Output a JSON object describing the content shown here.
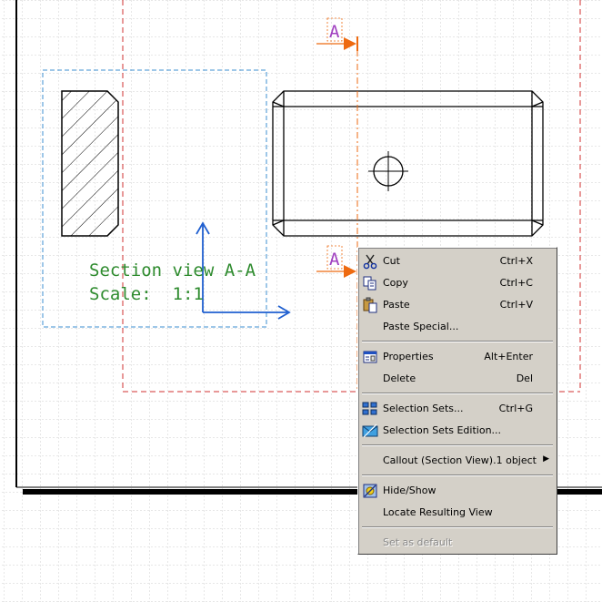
{
  "drawing": {
    "section_title": "Section view A-A",
    "scale_label": "Scale:  1:1",
    "callout_top_label": "A",
    "callout_bottom_label": "A",
    "colors": {
      "grid": "#cfcfcf",
      "sheet_border": "#000000",
      "view_frame": "#3c8fd0",
      "red_frame": "#d03030",
      "callout": "#ee6a10",
      "callout_label": "#a040c0",
      "axis": "#1f5fd0",
      "text": "#2e8b2e"
    }
  },
  "context_menu": {
    "items": [
      {
        "label": "Cut",
        "shortcut": "Ctrl+X",
        "icon": "scissors-icon"
      },
      {
        "label": "Copy",
        "shortcut": "Ctrl+C",
        "icon": "copy-icon"
      },
      {
        "label": "Paste",
        "shortcut": "Ctrl+V",
        "icon": "paste-icon"
      },
      {
        "label": "Paste Special...",
        "shortcut": ""
      },
      {
        "label": "Properties",
        "shortcut": "Alt+Enter",
        "icon": "properties-icon"
      },
      {
        "label": "Delete",
        "shortcut": "Del"
      },
      {
        "label": "Selection Sets...",
        "shortcut": "Ctrl+G",
        "icon": "selection-sets-icon"
      },
      {
        "label": "Selection Sets Edition...",
        "shortcut": "",
        "icon": "selection-sets-edition-icon"
      },
      {
        "label": "Callout (Section View).1 object",
        "shortcut": "",
        "submenu": true
      },
      {
        "label": "Hide/Show",
        "shortcut": "",
        "icon": "hide-show-icon"
      },
      {
        "label": "Locate Resulting View",
        "shortcut": ""
      },
      {
        "label": "Set as default",
        "shortcut": "",
        "disabled": true
      }
    ]
  }
}
